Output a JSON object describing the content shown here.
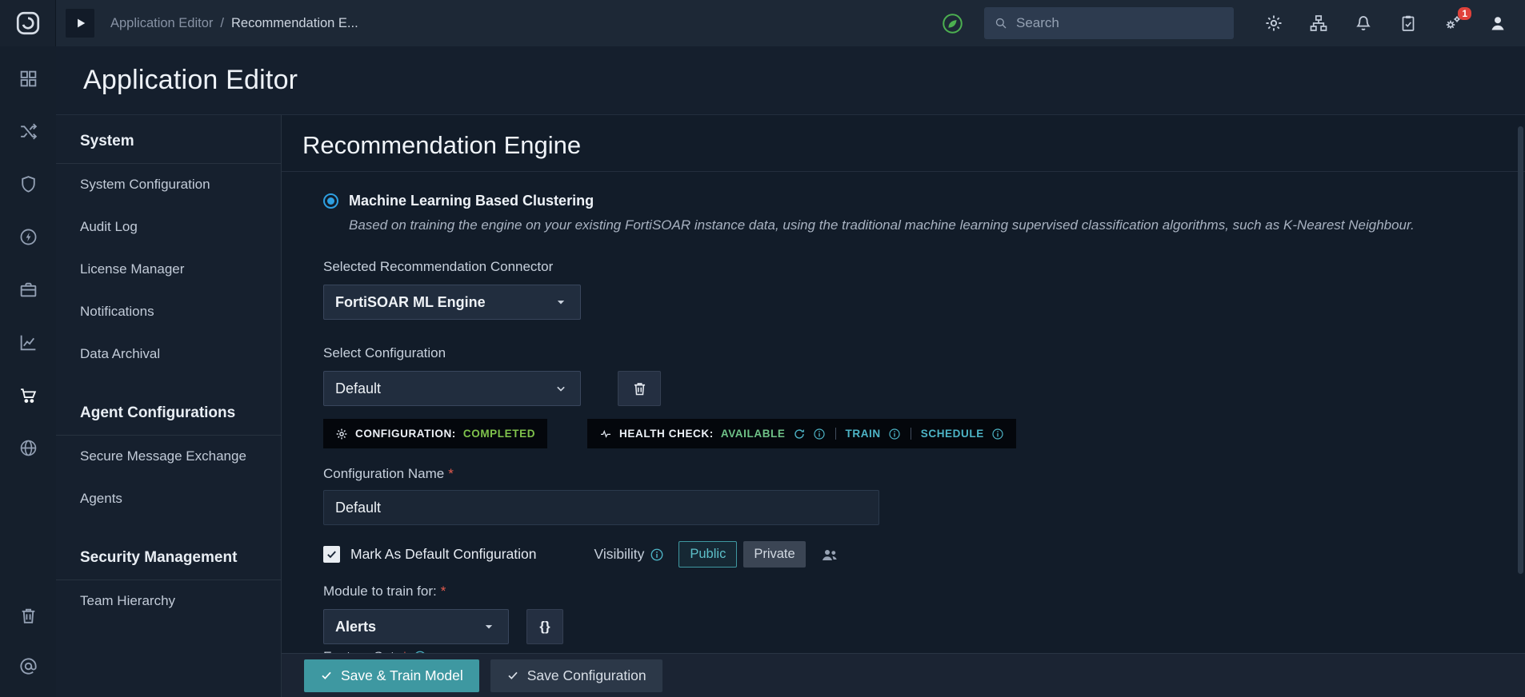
{
  "colors": {
    "accent_teal": "#45b2c0",
    "success_green": "#7fc24c",
    "radio_blue": "#2e9fe0",
    "badge_red": "#e0423b"
  },
  "topbar": {
    "breadcrumb": {
      "app": "Application Editor",
      "separator": "/",
      "page": "Recommendation E..."
    },
    "search_placeholder": "Search",
    "notification_badge": "1"
  },
  "page_title": "Application Editor",
  "sidebar": {
    "sections": [
      {
        "title": "System",
        "items": [
          "System Configuration",
          "Audit Log",
          "License Manager",
          "Notifications",
          "Data Archival"
        ]
      },
      {
        "title": "Agent Configurations",
        "items": [
          "Secure Message Exchange",
          "Agents"
        ]
      },
      {
        "title": "Security Management",
        "items": [
          "Team Hierarchy"
        ]
      }
    ]
  },
  "content": {
    "title": "Recommendation Engine",
    "ml_option": {
      "label": "Machine Learning Based Clustering",
      "description": "Based on training the engine on your existing FortiSOAR instance data, using the traditional machine learning supervised classification algorithms, such as K-Nearest Neighbour."
    },
    "connector_label": "Selected Recommendation Connector",
    "connector_value": "FortiSOAR ML Engine",
    "configuration_label": "Select Configuration",
    "configuration_value": "Default",
    "status": {
      "configuration_label": "CONFIGURATION:",
      "configuration_value": "COMPLETED",
      "health_label": "HEALTH CHECK:",
      "health_value": "AVAILABLE",
      "train_label": "TRAIN",
      "schedule_label": "SCHEDULE"
    },
    "name_label": "Configuration Name",
    "required_marker": "*",
    "name_value": "Default",
    "default_checkbox_label": "Mark As Default Configuration",
    "visibility": {
      "label": "Visibility",
      "public_label": "Public",
      "private_label": "Private"
    },
    "module_label": "Module to train for:",
    "module_value": "Alerts",
    "json_toggle_label": "{}",
    "feature_set_label": "Feature Set:",
    "footer": {
      "save_train_label": "Save & Train Model",
      "save_config_label": "Save Configuration"
    }
  }
}
